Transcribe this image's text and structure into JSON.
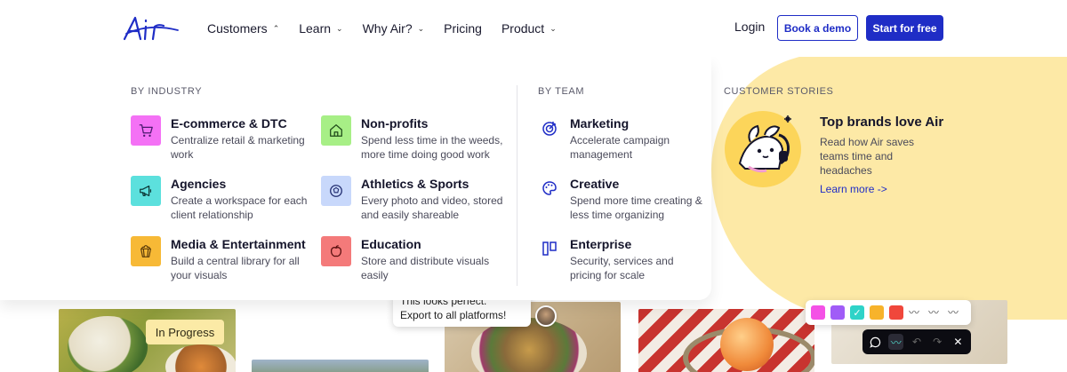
{
  "header": {
    "logo_text": "Air",
    "nav": [
      {
        "label": "Customers",
        "chevron": "up"
      },
      {
        "label": "Learn",
        "chevron": "down"
      },
      {
        "label": "Why Air?",
        "chevron": "down"
      },
      {
        "label": "Pricing",
        "chevron": ""
      },
      {
        "label": "Product",
        "chevron": "down"
      }
    ],
    "login": "Login",
    "book_demo": "Book a demo",
    "start_free": "Start for free"
  },
  "menu": {
    "by_industry": {
      "heading": "BY INDUSTRY",
      "items": [
        {
          "title": "E-commerce & DTC",
          "desc1": "Centralize retail & marketing",
          "desc2": "work",
          "icon": "cart-icon",
          "color": "#f471f5"
        },
        {
          "title": "Non-profits",
          "desc1": "Spend less time in the weeds,",
          "desc2": "more time doing good work",
          "icon": "house-icon",
          "color": "#a7ef86"
        },
        {
          "title": "Agencies",
          "desc1": "Create a workspace for each",
          "desc2": "client relationship",
          "icon": "megaphone-icon",
          "color": "#5ce0dd"
        },
        {
          "title": "Athletics & Sports",
          "desc1": "Every photo and video, stored",
          "desc2": "and easily shareable",
          "icon": "ball-icon",
          "color": "#c8d8fb"
        },
        {
          "title": "Media & Entertainment",
          "desc1": "Build a central library for all",
          "desc2": "your visuals",
          "icon": "popcorn-icon",
          "color": "#f7b936"
        },
        {
          "title": "Education",
          "desc1": "Store and distribute visuals",
          "desc2": "easily",
          "icon": "apple-icon",
          "color": "#f47a7a"
        }
      ]
    },
    "by_team": {
      "heading": "BY TEAM",
      "items": [
        {
          "title": "Marketing",
          "desc1": "Accelerate campaign",
          "desc2": "management",
          "icon": "target-icon"
        },
        {
          "title": "Creative",
          "desc1": "Spend more time creating &",
          "desc2": "less time organizing",
          "icon": "palette-icon"
        },
        {
          "title": "Enterprise",
          "desc1": "Security, services and",
          "desc2": "pricing for scale",
          "icon": "building-icon"
        }
      ]
    },
    "customer_stories": {
      "heading": "CUSTOMER STORIES",
      "title": "Top brands love Air",
      "desc": "Read how Air saves teams time and headaches",
      "link": "Learn more ->"
    }
  },
  "background": {
    "badge": "In Progress",
    "comment_line1": "This looks perfect.",
    "comment_line2": "Export to all platforms!",
    "swatches": [
      "#f451e6",
      "#a05cf7",
      "#2fd3c8",
      "#f7b32b",
      "#f0473b"
    ]
  },
  "colors": {
    "brand_blue": "#1f2dc6",
    "accent_yellow": "#fde9a6"
  }
}
